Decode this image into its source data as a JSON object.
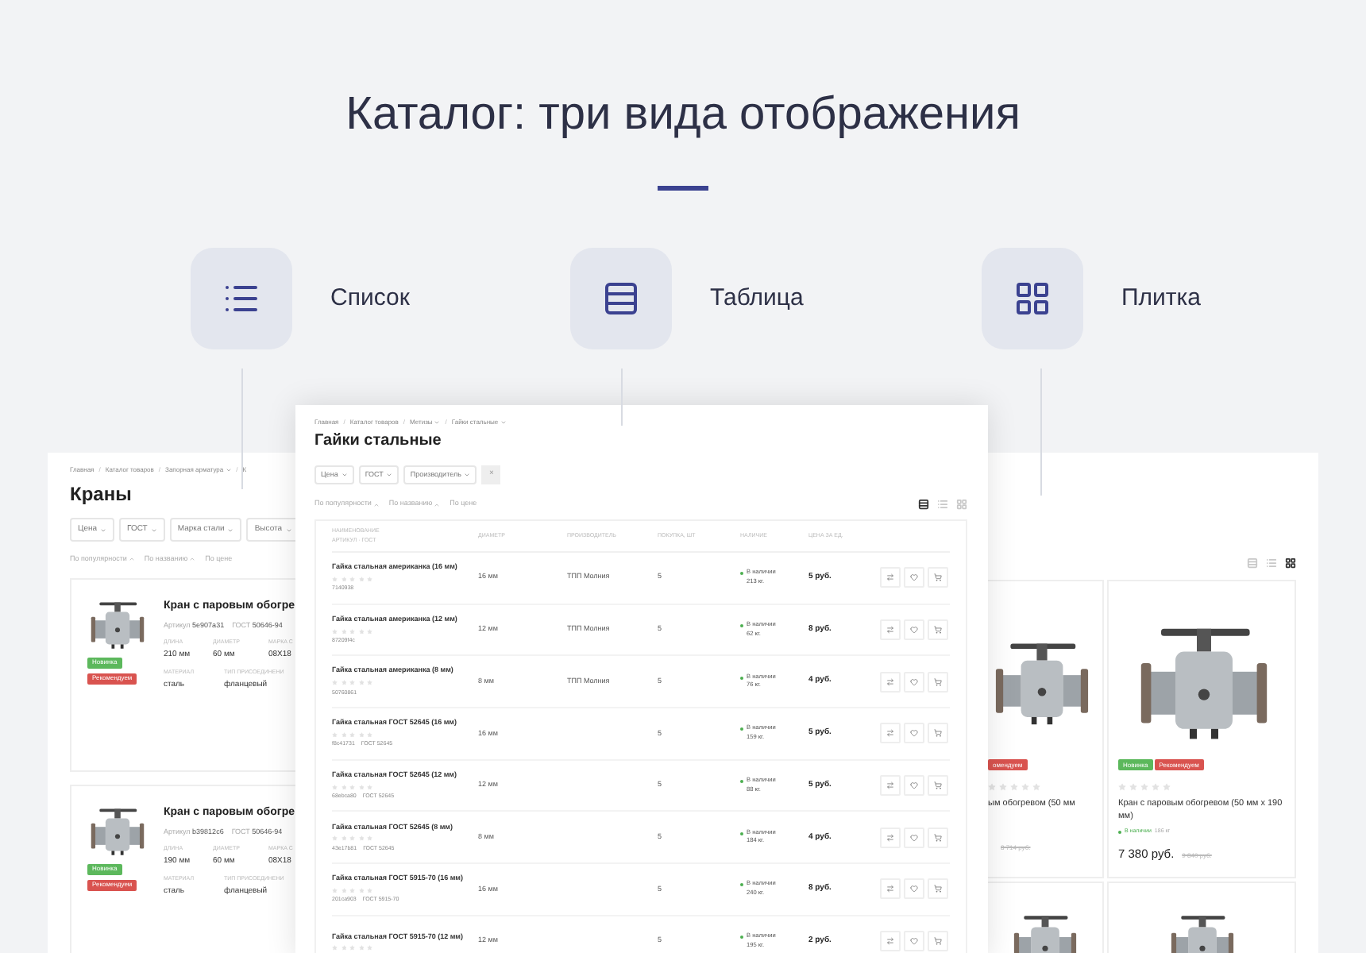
{
  "title": "Каталог: три вида отображения",
  "views": [
    {
      "label": "Список",
      "kind": "list"
    },
    {
      "label": "Таблица",
      "kind": "table"
    },
    {
      "label": "Плитка",
      "kind": "tiles"
    }
  ],
  "list_panel": {
    "separator": "/",
    "breadcrumbs": [
      {
        "label": "Главная",
        "menu": false
      },
      {
        "label": "Каталог товаров",
        "menu": false
      },
      {
        "label": "Запорная арматура",
        "menu": true
      },
      {
        "label": "К",
        "menu": false
      }
    ],
    "heading": "Краны",
    "filters": [
      "Цена",
      "ГОСТ",
      "Марка стали",
      "Высота"
    ],
    "sort": [
      {
        "label": "По популярности",
        "arrow": true
      },
      {
        "label": "По названию",
        "arrow": true
      },
      {
        "label": "По цене",
        "arrow": false
      }
    ],
    "products": [
      {
        "title": "Кран с паровым обогре",
        "article_label": "Артикул",
        "article": "5e907a31",
        "gost_label": "ГОСТ",
        "gost": "50646-94",
        "badges": [
          {
            "label": "Новинка",
            "color": "#5cb85c"
          },
          {
            "label": "Рекомендуем",
            "color": "#d9534f"
          }
        ],
        "specs": [
          {
            "label": "ДЛИНА",
            "value": "210 мм"
          },
          {
            "label": "ДИАМЕТР",
            "value": "60 мм"
          },
          {
            "label": "МАРКА С",
            "value": "08Х18"
          },
          {
            "label": "МАТЕРИАЛ",
            "value": "сталь"
          },
          {
            "label": "ТИП ПРИСОЕДИНЕНИ",
            "value": "фланцевый"
          }
        ]
      },
      {
        "title": "Кран с паровым обогре",
        "article_label": "Артикул",
        "article": "b39812c6",
        "gost_label": "ГОСТ",
        "gost": "50646-94",
        "badges": [
          {
            "label": "Новинка",
            "color": "#5cb85c"
          },
          {
            "label": "Рекомендуем",
            "color": "#d9534f"
          }
        ],
        "specs": [
          {
            "label": "ДЛИНА",
            "value": "190 мм"
          },
          {
            "label": "ДИАМЕТР",
            "value": "60 мм"
          },
          {
            "label": "МАРКА С",
            "value": "08Х18"
          },
          {
            "label": "МАТЕРИАЛ",
            "value": "сталь"
          },
          {
            "label": "ТИП ПРИСОЕДИНЕНИ",
            "value": "фланцевый"
          }
        ]
      }
    ]
  },
  "table_panel": {
    "separator": "/",
    "breadcrumbs": [
      {
        "label": "Главная",
        "menu": false
      },
      {
        "label": "Каталог товаров",
        "menu": false
      },
      {
        "label": "Метизы",
        "menu": true
      },
      {
        "label": "Гайки стальные",
        "menu": true
      }
    ],
    "heading": "Гайки стальные",
    "filters": [
      "Цена",
      "ГОСТ",
      "Производитель"
    ],
    "clear_button": "×",
    "sort": [
      {
        "label": "По популярности",
        "arrow": true
      },
      {
        "label": "По названию",
        "arrow": true
      },
      {
        "label": "По цене",
        "arrow": false
      }
    ],
    "view_switch": [
      {
        "kind": "table",
        "selected": true
      },
      {
        "kind": "list",
        "selected": false
      },
      {
        "kind": "tiles",
        "selected": false
      }
    ],
    "columns": [
      "НАИМЕНОВАНИЕ",
      "АРТИКУЛ · ГОСТ",
      "ДИАМЕТР",
      "ПРОИЗВОДИТЕЛЬ",
      "ПОКУПКА, ШТ",
      "НАЛИЧИЕ",
      "ЦЕНА ЗА ЕД."
    ],
    "rows": [
      {
        "name": "Гайка стальная американка (16 мм)",
        "stars": 0,
        "article": "7140938",
        "gost": "",
        "diameter": "16 мм",
        "manufacturer": "ТПП Молния",
        "quantity": "5",
        "stock": "В наличии",
        "amount": "213 кг.",
        "price": "5 руб."
      },
      {
        "name": "Гайка стальная американка (12 мм)",
        "stars": 0,
        "article": "87209f4c",
        "gost": "",
        "diameter": "12 мм",
        "manufacturer": "ТПП Молния",
        "quantity": "5",
        "stock": "В наличии",
        "amount": "62 кг.",
        "price": "8 руб."
      },
      {
        "name": "Гайка стальная американка (8 мм)",
        "stars": 0,
        "article": "50760861",
        "gost": "",
        "diameter": "8 мм",
        "manufacturer": "ТПП Молния",
        "quantity": "5",
        "stock": "В наличии",
        "amount": "76 кг.",
        "price": "4 руб."
      },
      {
        "name": "Гайка стальная ГОСТ 52645 (16 мм)",
        "stars": 0,
        "article": "f8c41731",
        "gost": "ГОСТ 52645",
        "diameter": "16 мм",
        "manufacturer": "",
        "quantity": "5",
        "stock": "В наличии",
        "amount": "159 кг.",
        "price": "5 руб."
      },
      {
        "name": "Гайка стальная ГОСТ 52645 (12 мм)",
        "stars": 0,
        "article": "68ebca80",
        "gost": "ГОСТ 52645",
        "diameter": "12 мм",
        "manufacturer": "",
        "quantity": "5",
        "stock": "В наличии",
        "amount": "88 кг.",
        "price": "5 руб."
      },
      {
        "name": "Гайка стальная ГОСТ 52645 (8 мм)",
        "stars": 0,
        "article": "43e17b81",
        "gost": "ГОСТ 52645",
        "diameter": "8 мм",
        "manufacturer": "",
        "quantity": "5",
        "stock": "В наличии",
        "amount": "184 кг.",
        "price": "4 руб."
      },
      {
        "name": "Гайка стальная ГОСТ 5915-70 (16 мм)",
        "stars": 0,
        "article": "201ca903",
        "gost": "ГОСТ 5915-70",
        "diameter": "16 мм",
        "manufacturer": "",
        "quantity": "5",
        "stock": "В наличии",
        "amount": "240 кг.",
        "price": "8 руб."
      },
      {
        "name": "Гайка стальная ГОСТ 5915-70 (12 мм)",
        "stars": 0,
        "article": "",
        "gost": "",
        "diameter": "12 мм",
        "manufacturer": "",
        "quantity": "5",
        "stock": "В наличии",
        "amount": "195 кг.",
        "price": "2 руб."
      }
    ]
  },
  "tile_panel": {
    "view_switch": [
      {
        "kind": "table",
        "selected": false
      },
      {
        "kind": "list",
        "selected": false
      },
      {
        "kind": "tiles",
        "selected": true
      }
    ],
    "products": [
      {
        "badges": [
          {
            "label": "омендуем",
            "color": "#d9534f"
          }
        ],
        "stars": 0,
        "title": "ым обогревом (50 мм",
        "old_price": "8 714 руб."
      },
      {
        "badges": [
          {
            "label": "Новинка",
            "color": "#5cb85c"
          },
          {
            "label": "Рекомендуем",
            "color": "#d9534f"
          }
        ],
        "stars": 0,
        "title": "Кран с паровым обогревом (50 мм х 190 мм)",
        "stock": "В наличии",
        "amount": "186 кг",
        "price": "7 380 руб.",
        "old_price": "9 840 руб."
      }
    ]
  }
}
